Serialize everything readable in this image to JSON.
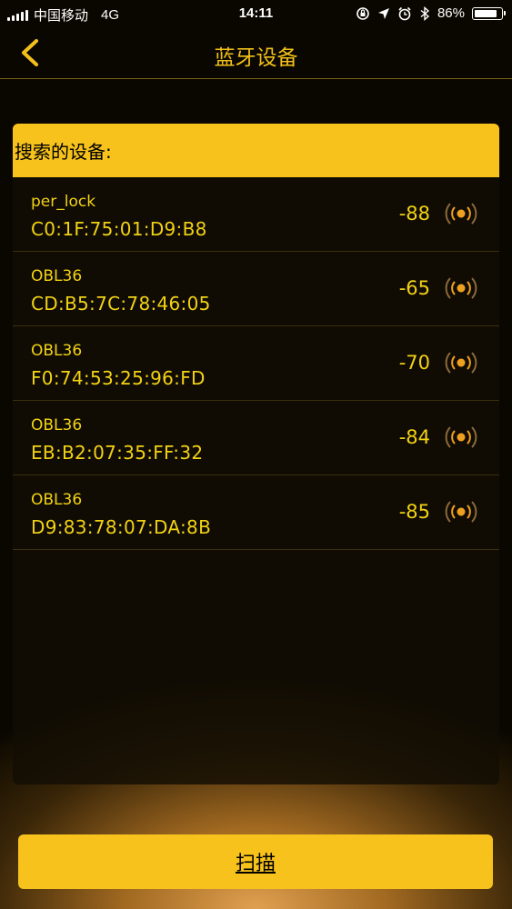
{
  "status_bar": {
    "carrier": "中国移动",
    "network": "4G",
    "time": "14:11",
    "battery": "86%",
    "battery_level": 0.86,
    "icons": [
      "orientation-lock-icon",
      "location-icon",
      "alarm-icon",
      "bluetooth-icon"
    ]
  },
  "nav": {
    "back_icon": "chevron-left-icon",
    "title": "蓝牙设备"
  },
  "panel": {
    "header": "搜索的设备:"
  },
  "devices": [
    {
      "name": "per_lock",
      "mac": "C0:1F:75:01:D9:B8",
      "rssi": "-88"
    },
    {
      "name": "OBL36",
      "mac": "CD:B5:7C:78:46:05",
      "rssi": "-65"
    },
    {
      "name": "OBL36",
      "mac": "F0:74:53:25:96:FD",
      "rssi": "-70"
    },
    {
      "name": "OBL36",
      "mac": "EB:B2:07:35:FF:32",
      "rssi": "-84"
    },
    {
      "name": "OBL36",
      "mac": "D9:83:78:07:DA:8B",
      "rssi": "-85"
    }
  ],
  "scan_button": {
    "label": "扫描"
  },
  "colors": {
    "accent": "#f7c21b",
    "text_yellow": "#f2d214",
    "signal_orange": "#f0a020"
  }
}
